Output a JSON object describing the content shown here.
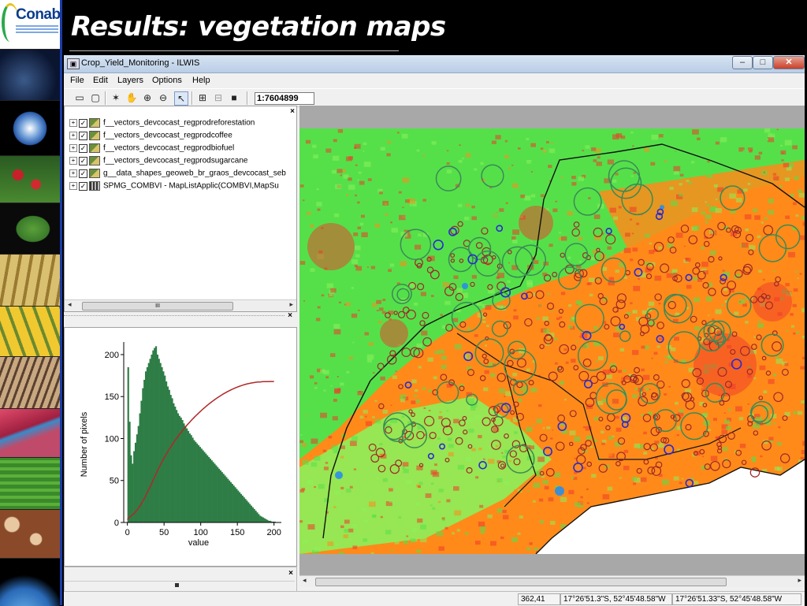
{
  "slide": {
    "title": "Results: vegetation maps"
  },
  "logo": {
    "text": "Conab"
  },
  "window": {
    "title": "Crop_Yield_Monitoring - ILWIS",
    "btn_minimize": "–",
    "btn_maximize": "□",
    "btn_close": "✕"
  },
  "menu": {
    "file": "File",
    "edit": "Edit",
    "layers": "Layers",
    "options": "Options",
    "help": "Help"
  },
  "toolbar": {
    "scale": "1:7604899"
  },
  "layers": [
    {
      "label": "f__vectors_devcocast_regprodreforestation",
      "type": "vector"
    },
    {
      "label": "f__vectors_devcocast_regprodcoffee",
      "type": "vector"
    },
    {
      "label": "f__vectors_devcocast_regprodbiofuel",
      "type": "vector"
    },
    {
      "label": "f__vectors_devcocast_regprodsugarcane",
      "type": "vector"
    },
    {
      "label": "g__data_shapes_geoweb_br_graos_devcocast_seb",
      "type": "vector"
    },
    {
      "label": "SPMG_COMBVI - MapListApplic(COMBVI,MapSu",
      "type": "raster"
    }
  ],
  "panel_close": "×",
  "scroll_grip": "III",
  "chart_data": {
    "type": "bar",
    "title": "",
    "xlabel": "value",
    "ylabel": "Number of pixels",
    "xlim": [
      -5,
      210
    ],
    "ylim": [
      0,
      215
    ],
    "xticks": [
      "0",
      "50",
      "100",
      "150",
      "200"
    ],
    "yticks": [
      "0",
      "50",
      "100",
      "150",
      "200"
    ],
    "bar_color": "#2e7d46",
    "curve_color": "#b0282a",
    "x": [
      0,
      2,
      4,
      6,
      8,
      10,
      12,
      14,
      16,
      18,
      20,
      22,
      24,
      26,
      28,
      30,
      32,
      34,
      36,
      38,
      40,
      42,
      44,
      46,
      48,
      50,
      52,
      54,
      56,
      58,
      60,
      62,
      64,
      66,
      68,
      70,
      72,
      74,
      76,
      78,
      80,
      82,
      84,
      86,
      88,
      90,
      92,
      94,
      96,
      98,
      100,
      102,
      104,
      106,
      108,
      110,
      112,
      114,
      116,
      118,
      120,
      122,
      124,
      126,
      128,
      130,
      132,
      134,
      136,
      138,
      140,
      142,
      144,
      146,
      148,
      150,
      152,
      154,
      156,
      158,
      160,
      162,
      164,
      166,
      168,
      170,
      172,
      174,
      176,
      178,
      180,
      182,
      184,
      186,
      188,
      190,
      192,
      194,
      196,
      198,
      200
    ],
    "values": [
      185,
      120,
      80,
      70,
      85,
      95,
      105,
      115,
      130,
      145,
      160,
      170,
      180,
      185,
      190,
      195,
      200,
      205,
      208,
      210,
      200,
      195,
      190,
      185,
      180,
      175,
      168,
      162,
      158,
      152,
      148,
      142,
      138,
      134,
      130,
      127,
      125,
      122,
      118,
      115,
      112,
      109,
      106,
      104,
      101,
      98,
      96,
      94,
      92,
      90,
      88,
      86,
      84,
      82,
      80,
      78,
      76,
      74,
      72,
      70,
      68,
      66,
      64,
      62,
      60,
      58,
      56,
      54,
      52,
      50,
      48,
      46,
      44,
      42,
      40,
      38,
      36,
      34,
      32,
      30,
      28,
      26,
      24,
      22,
      20,
      18,
      16,
      14,
      12,
      10,
      8,
      7,
      6,
      5,
      4,
      3,
      2,
      2,
      1,
      1,
      1
    ],
    "cumulative_max": 168
  },
  "map": {
    "colors": {
      "orange": "#ff8a1a",
      "red": "#ef3a2a",
      "green": "#55e04a",
      "lightgreen": "#8cf05a",
      "blue": "#2a8ee8",
      "boundary": "#111111",
      "circle_green": "#3a8a55",
      "circle_red": "#a02828",
      "circle_blue": "#2a2ad0"
    }
  },
  "status": {
    "value": "362,41",
    "coord1": "17°26'51.3\"S, 52°45'48.58\"W",
    "coord2": "17°26'51.33\"S, 52°45'48.58\"W"
  }
}
